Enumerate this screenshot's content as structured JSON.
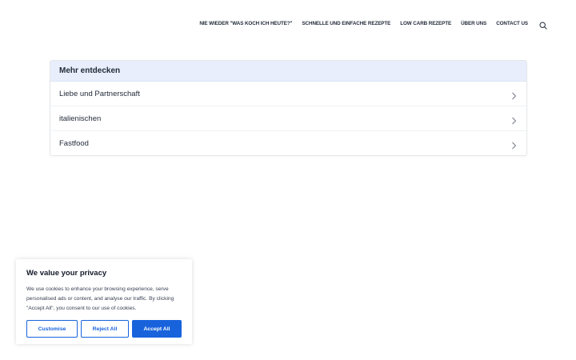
{
  "nav": {
    "items": [
      {
        "label": "NIE WIEDER \"WAS KOCH ICH HEUTE?\""
      },
      {
        "label": "SCHNELLE UND EINFACHE REZEPTE"
      },
      {
        "label": "LOW CARB REZEPTE"
      },
      {
        "label": "ÜBER UNS"
      },
      {
        "label": "CONTACT US"
      }
    ],
    "search_icon": "search-icon"
  },
  "discover": {
    "title": "Mehr entdecken",
    "items": [
      {
        "label": "Liebe und Partnerschaft"
      },
      {
        "label": "italienischen"
      },
      {
        "label": "Fastfood"
      }
    ],
    "chevron_icon": "chevron-right-icon"
  },
  "cookie": {
    "title": "We value your privacy",
    "text": "We use cookies to enhance your browsing experience, serve personalised ads or content, and analyse our traffic. By clicking \"Accept All\", you consent to our use of cookies.",
    "customise_label": "Customise",
    "reject_label": "Reject All",
    "accept_label": "Accept All",
    "accent_color": "#1863dc"
  }
}
